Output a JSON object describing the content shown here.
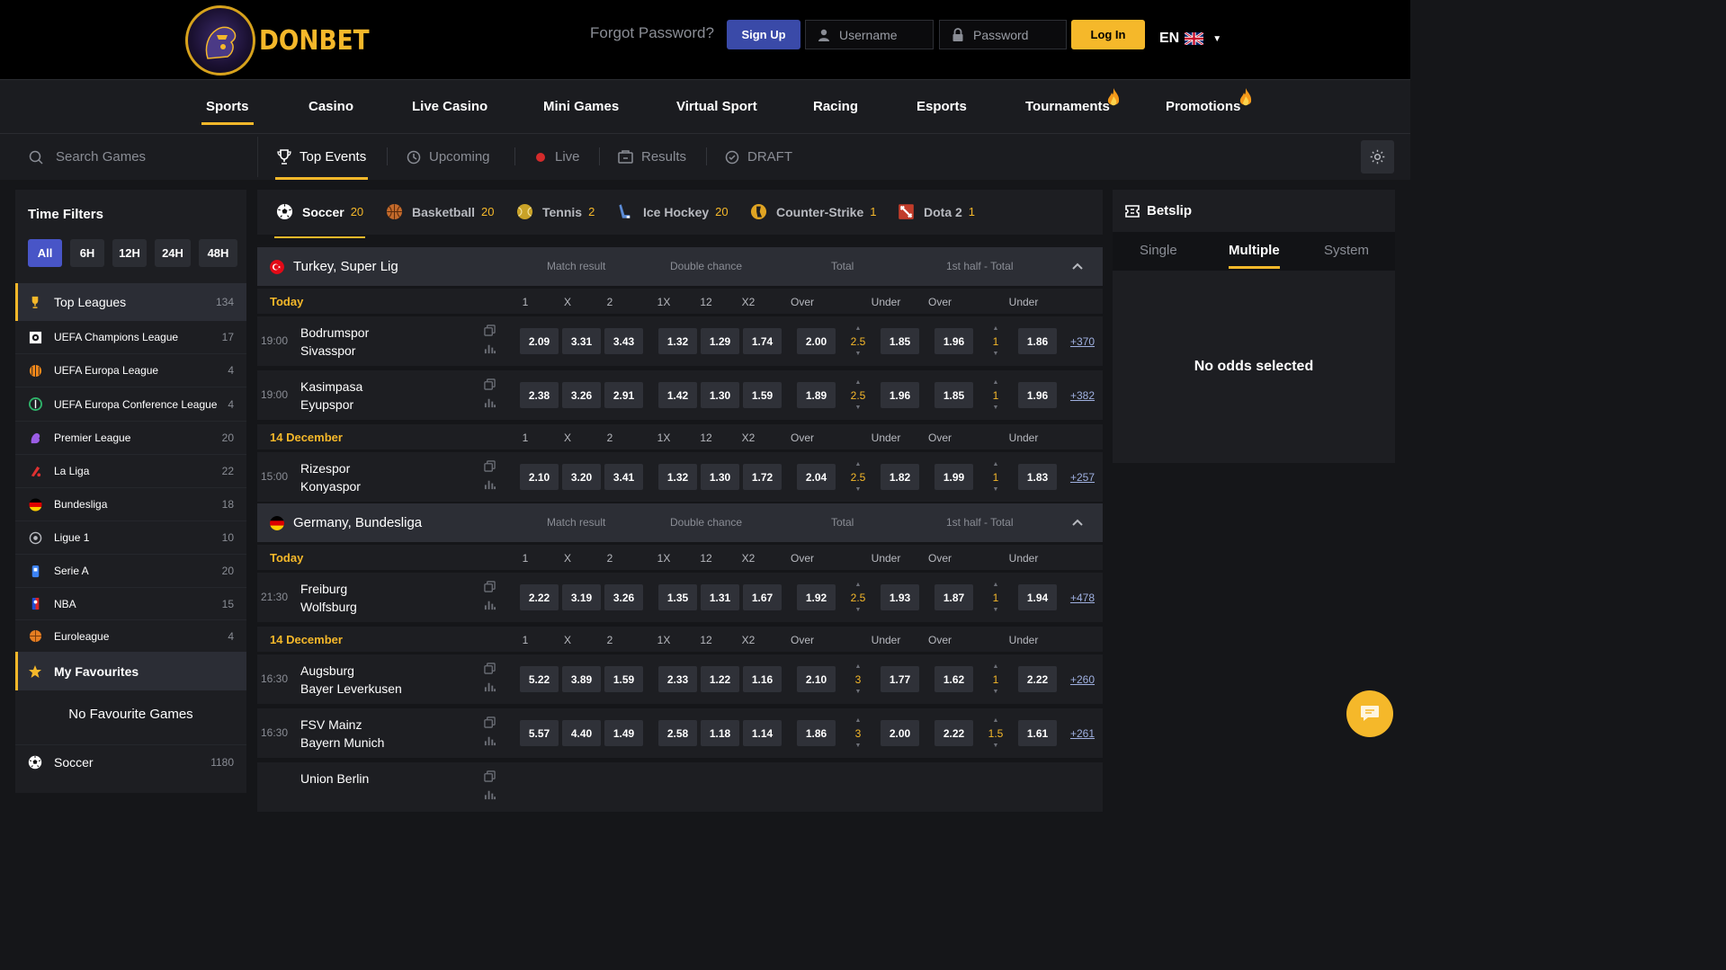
{
  "brand": {
    "name": "DONBET"
  },
  "header": {
    "forgot": "Forgot Password?",
    "signup": "Sign Up",
    "username_placeholder": "Username",
    "password_placeholder": "Password",
    "login": "Log In",
    "lang": "EN"
  },
  "mainnav": [
    "Sports",
    "Casino",
    "Live Casino",
    "Mini Games",
    "Virtual Sport",
    "Racing",
    "Esports",
    "Tournaments",
    "Promotions"
  ],
  "subnav": {
    "search_placeholder": "Search Games",
    "tabs": [
      "Top Events",
      "Upcoming",
      "Live",
      "Results",
      "DRAFT"
    ]
  },
  "sidebar": {
    "title": "Time Filters",
    "filters": [
      "All",
      "6H",
      "12H",
      "24H",
      "48H"
    ],
    "top_leagues": {
      "label": "Top Leagues",
      "count": "134"
    },
    "leagues": [
      {
        "label": "UEFA Champions League",
        "count": "17"
      },
      {
        "label": "UEFA Europa League",
        "count": "4"
      },
      {
        "label": "UEFA Europa Conference League",
        "count": "4"
      },
      {
        "label": "Premier League",
        "count": "20"
      },
      {
        "label": "La Liga",
        "count": "22"
      },
      {
        "label": "Bundesliga",
        "count": "18"
      },
      {
        "label": "Ligue 1",
        "count": "10"
      },
      {
        "label": "Serie A",
        "count": "20"
      },
      {
        "label": "NBA",
        "count": "15"
      },
      {
        "label": "Euroleague",
        "count": "4"
      }
    ],
    "favourites": "My Favourites",
    "no_favourites": "No Favourite Games",
    "soccer": {
      "label": "Soccer",
      "count": "1180"
    }
  },
  "sport_tabs": [
    {
      "label": "Soccer",
      "count": "20"
    },
    {
      "label": "Basketball",
      "count": "20"
    },
    {
      "label": "Tennis",
      "count": "2"
    },
    {
      "label": "Ice Hockey",
      "count": "20"
    },
    {
      "label": "Counter-Strike",
      "count": "1"
    },
    {
      "label": "Dota 2",
      "count": "1"
    }
  ],
  "market_headers": [
    "Match result",
    "Double chance",
    "Total",
    "1st half - Total"
  ],
  "col_labels": [
    "1",
    "X",
    "2",
    "1X",
    "12",
    "X2",
    "Over",
    "Under",
    "Over",
    "Under"
  ],
  "leagues": [
    {
      "name": "Turkey, Super Lig",
      "days": [
        {
          "label": "Today",
          "matches": [
            {
              "time": "19:00",
              "home": "Bodrumspor",
              "away": "Sivasspor",
              "odds": [
                "2.09",
                "3.31",
                "3.43",
                "1.32",
                "1.29",
                "1.74",
                "2.00",
                "1.85",
                "1.96",
                "1.86"
              ],
              "total": "2.5",
              "half": "1",
              "more": "+370"
            },
            {
              "time": "19:00",
              "home": "Kasimpasa",
              "away": "Eyupspor",
              "odds": [
                "2.38",
                "3.26",
                "2.91",
                "1.42",
                "1.30",
                "1.59",
                "1.89",
                "1.96",
                "1.85",
                "1.96"
              ],
              "total": "2.5",
              "half": "1",
              "more": "+382"
            }
          ]
        },
        {
          "label": "14 December",
          "matches": [
            {
              "time": "15:00",
              "home": "Rizespor",
              "away": "Konyaspor",
              "odds": [
                "2.10",
                "3.20",
                "3.41",
                "1.32",
                "1.30",
                "1.72",
                "2.04",
                "1.82",
                "1.99",
                "1.83"
              ],
              "total": "2.5",
              "half": "1",
              "more": "+257"
            }
          ]
        }
      ]
    },
    {
      "name": "Germany, Bundesliga",
      "days": [
        {
          "label": "Today",
          "matches": [
            {
              "time": "21:30",
              "home": "Freiburg",
              "away": "Wolfsburg",
              "odds": [
                "2.22",
                "3.19",
                "3.26",
                "1.35",
                "1.31",
                "1.67",
                "1.92",
                "1.93",
                "1.87",
                "1.94"
              ],
              "total": "2.5",
              "half": "1",
              "more": "+478"
            }
          ]
        },
        {
          "label": "14 December",
          "matches": [
            {
              "time": "16:30",
              "home": "Augsburg",
              "away": "Bayer Leverkusen",
              "odds": [
                "5.22",
                "3.89",
                "1.59",
                "2.33",
                "1.22",
                "1.16",
                "2.10",
                "1.77",
                "1.62",
                "2.22"
              ],
              "total": "3",
              "half": "1",
              "more": "+260"
            },
            {
              "time": "16:30",
              "home": "FSV Mainz",
              "away": "Bayern Munich",
              "odds": [
                "5.57",
                "4.40",
                "1.49",
                "2.58",
                "1.18",
                "1.14",
                "1.86",
                "2.00",
                "2.22",
                "1.61"
              ],
              "total": "3",
              "half": "1.5",
              "more": "+261"
            },
            {
              "time": "",
              "home": "Union Berlin",
              "away": "",
              "odds": [],
              "total": "",
              "half": "",
              "more": ""
            }
          ]
        }
      ]
    }
  ],
  "betslip": {
    "title": "Betslip",
    "tabs": [
      "Single",
      "Multiple",
      "System"
    ],
    "empty": "No odds selected"
  },
  "colors": {
    "accent": "#f5b82a",
    "primary": "#3a4aa8",
    "bg": "#151619",
    "panel": "#1d1e22"
  }
}
